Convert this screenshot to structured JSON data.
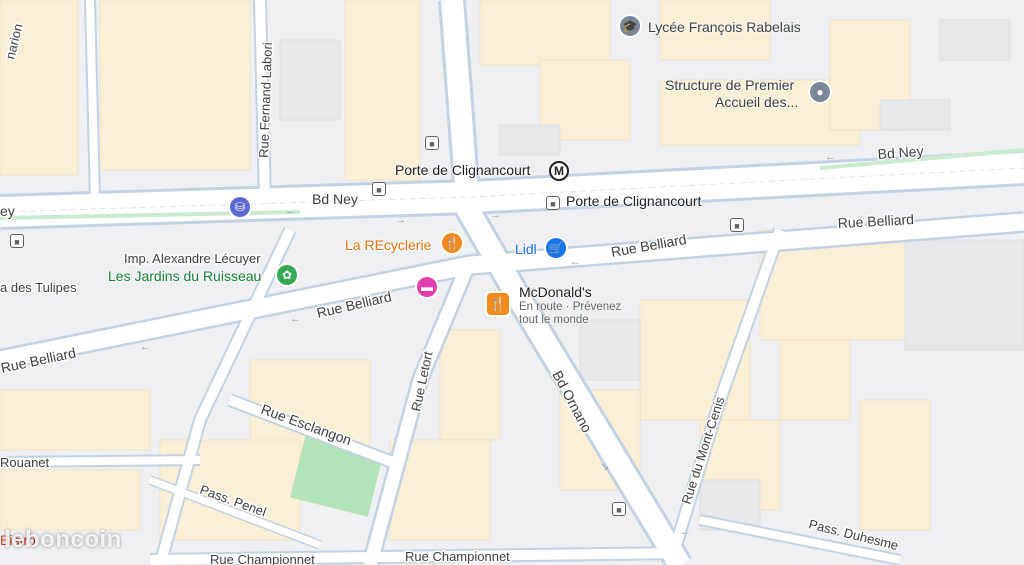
{
  "map": {
    "streets": {
      "bd_ney_right": "Bd Ney",
      "bd_ney_left": "Bd Ney",
      "rue_belliard_right": "Rue Belliard",
      "rue_belliard_mid": "Rue Belliard",
      "rue_belliard_center": "Rue Belliard",
      "rue_belliard_left": "Rue Belliard",
      "rue_fernand_labori": "Rue Fernand Labori",
      "imp_alexandre_lecuyer": "Imp. Alexandre Lécuyer",
      "rue_des_tulipes": "a des Tulipes",
      "rue_letort": "Rue Letort",
      "bd_ornano": "Bd Ornano",
      "rue_esclangon": "Rue Esclangon",
      "rouanet": "Rouanet",
      "pass_penel": "Pass. Penel",
      "rue_championnet_left": "Rue Championnet",
      "rue_championnet_right": "Rue Championnet",
      "rue_du_mont_cenis": "Rue du Mont-Cenis",
      "pass_duhesme": "Pass. Duhesme",
      "top_left_partial": "narion",
      "ney_partial": "ey",
      "bistrot_partial": "Bistro"
    },
    "stations": {
      "metro_label": "Porte de Clignancourt",
      "metro_symbol": "M",
      "tram_label": "Porte de Clignancourt"
    },
    "pois": {
      "lycee": "Lycée François Rabelais",
      "structure_line1": "Structure de Premier",
      "structure_line2": "Accueil des...",
      "la_recyclerie": "La REcyclerie",
      "lidl": "Lidl",
      "jardins": "Les Jardins du Ruisseau",
      "mcdonalds": "McDonald's",
      "mcdonalds_sub1": "En route · Prévenez",
      "mcdonalds_sub2": "tout le monde"
    },
    "colors": {
      "background": "#eef0f3",
      "road": "#ffffff",
      "road_edge": "#aac0d8",
      "block": "#fbf0d6",
      "park": "#b3e3b8",
      "food_pin": "#f08c1e",
      "shop_pin": "#1a73e8",
      "hotel_pin": "#e040b0",
      "park_text": "#188038",
      "shop_text": "#1a73e8",
      "food_text": "#e8710a"
    },
    "icons": [
      "school-icon",
      "place-icon",
      "restaurant-icon",
      "shopping-cart-icon",
      "hotel-icon",
      "park-icon",
      "metro-icon",
      "bus-icon",
      "tram-icon",
      "bike-icon"
    ]
  },
  "watermark": "leboncoin"
}
